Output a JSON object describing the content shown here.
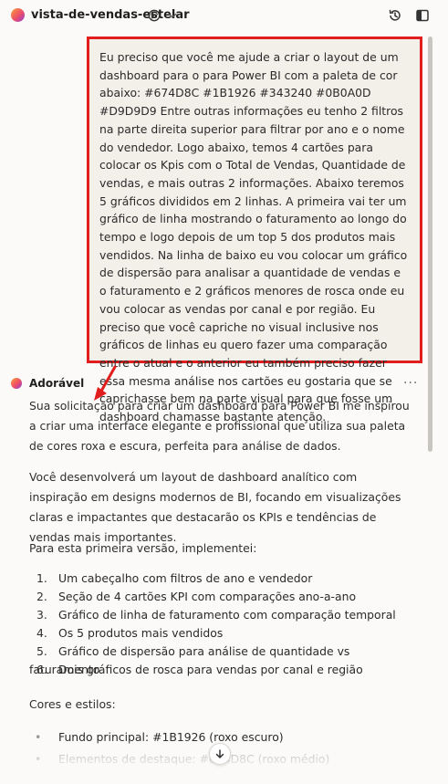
{
  "topbar": {
    "project_name": "vista-de-vendas-estelar",
    "icons": [
      "globe-icon",
      "chevron-down-icon",
      "history-icon",
      "sidebar-toggle-icon"
    ]
  },
  "user_message": {
    "text": "Eu preciso que você me ajude a criar o layout de um dashboard para o para Power BI com a paleta de cor abaixo: #674D8C #1B1926 #343240 #0B0A0D #D9D9D9 Entre outras informações eu tenho 2 filtros na parte direita superior para filtrar por ano e o nome do vendedor. Logo abaixo, temos 4 cartões para colocar os Kpis com o Total de Vendas, Quantidade de vendas, e mais outras 2 informações. Abaixo teremos 5 gráficos divididos em 2 linhas. A primeira vai ter um gráfico de linha mostrando o faturamento ao longo do tempo e logo depois de um top 5 dos produtos mais vendidos. Na linha de baixo eu vou colocar um gráfico de dispersão para analisar a quantidade de vendas e o faturamento e 2 gráficos menores de rosca onde eu vou colocar as vendas por canal e por região. Eu preciso que você capriche no visual inclusive nos gráficos de linhas eu quero fazer uma comparação entre o atual e o anterior eu também preciso fazer essa mesma análise nos cartões eu gostaria que se caprichasse bem na parte visual para que fosse um dashboard chamasse bastante atenção.",
    "highlight_color": "#e11d1d"
  },
  "assistant": {
    "name": "Adorável",
    "more_label": "···",
    "paragraph1": "Sua solicitação para criar um dashboard para Power BI me inspirou a criar uma interface elegante e profissional que utiliza sua paleta de cores roxa e escura, perfeita para análise de dados.",
    "paragraph2": "Você desenvolverá um layout de dashboard analítico com inspiração em designs modernos de BI, focando em visualizações claras e impactantes que destacarão os KPIs e tendências de vendas mais importantes.",
    "paragraph3": "Para esta primeira versão, implementei:",
    "steps": [
      "Um cabeçalho com filtros de ano e vendedor",
      "Seção de 4 cartões KPI com comparações ano-a-ano",
      "Gráfico de linha de faturamento com comparação temporal",
      "Os 5 produtos mais vendidos",
      "Gráfico de dispersão para análise de quantidade vs faturamento",
      "Dois gráficos de rosca para vendas por canal e região"
    ],
    "step_numbers": [
      "1.",
      "2.",
      "3.",
      "4.",
      "5.",
      "6."
    ],
    "paragraph4": "Cores e estilos:",
    "colors_list": [
      "Fundo principal: #1B1926 (roxo escuro)",
      "Elementos de destaque: #674D8C (roxo médio)"
    ],
    "bullet": "•"
  },
  "colors": {
    "accent_red": "#e11d1d",
    "background": "#fbfaf8",
    "bubble": "#f3efe9"
  }
}
